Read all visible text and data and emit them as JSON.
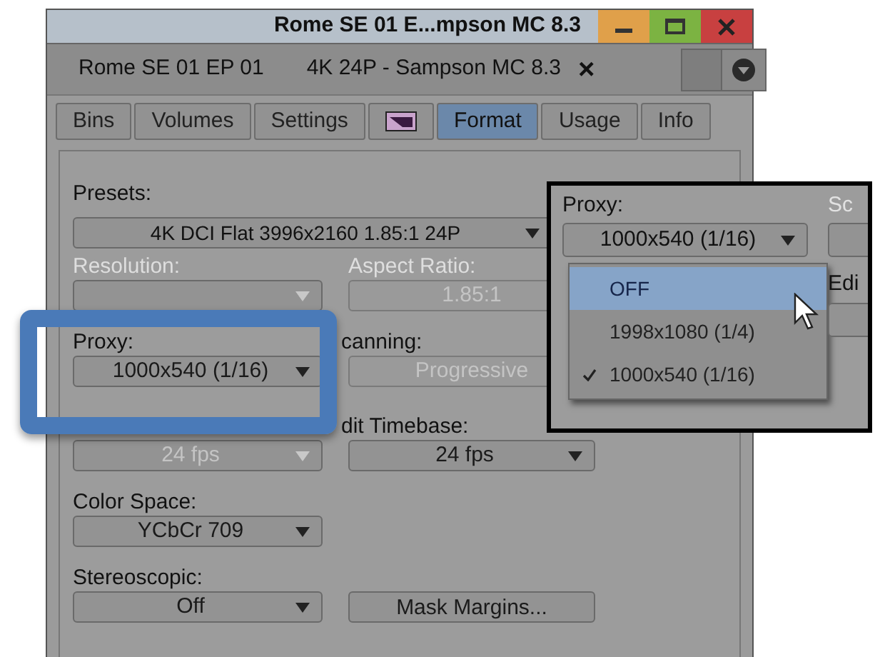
{
  "window": {
    "title": "Rome SE 01 E...mpson MC 8.3"
  },
  "document_tabs": [
    {
      "label": "Rome SE 01 EP 01"
    },
    {
      "label": "4K 24P - Sampson MC 8.3",
      "close": "×"
    }
  ],
  "tabs": [
    {
      "kind": "text",
      "label": "Bins",
      "selected": false
    },
    {
      "kind": "text",
      "label": "Volumes",
      "selected": false
    },
    {
      "kind": "text",
      "label": "Settings",
      "selected": false
    },
    {
      "kind": "icon",
      "selected": false
    },
    {
      "kind": "text",
      "label": "Format",
      "selected": true
    },
    {
      "kind": "text",
      "label": "Usage",
      "selected": false
    },
    {
      "kind": "text",
      "label": "Info",
      "selected": false
    }
  ],
  "presets": {
    "label": "Presets:",
    "value": "4K DCI Flat 3996x2160 1.85:1 24P"
  },
  "rows": [
    [
      {
        "kind": "dropdown",
        "label": "Resolution:",
        "disabled": true
      },
      {
        "kind": "field",
        "label": "Aspect Ratio:",
        "value": "1.85:1",
        "disabled": true
      }
    ],
    [
      {
        "kind": "dropdown",
        "label": "Proxy:",
        "value": "1000x540  (1/16)",
        "disabled": false
      },
      {
        "kind": "field",
        "label": "canning:",
        "value": "Progressive",
        "disabled": true
      }
    ],
    [
      {
        "kind": "dropdown",
        "value": "24 fps",
        "disabled": true
      },
      {
        "kind": "dropdown",
        "label": "dit Timebase:",
        "value": "24 fps",
        "disabled": false
      }
    ],
    [
      {
        "kind": "dropdown",
        "label": "Color Space:",
        "value": "YCbCr 709",
        "disabled": false
      }
    ],
    [
      {
        "kind": "dropdown",
        "label": "Stereoscopic:",
        "value": "Off",
        "disabled": false
      },
      {
        "kind": "button",
        "value": "Mask Margins...",
        "disabled": false
      }
    ]
  ],
  "inset": {
    "label": "Proxy:",
    "value": "1000x540  (1/16)",
    "side_labels": [
      "Sc",
      "Edi"
    ],
    "menu": [
      {
        "label": "OFF",
        "highlighted": true,
        "selected": false
      },
      {
        "label": "1998x1080  (1/4)",
        "highlighted": false,
        "selected": false
      },
      {
        "label": "1000x540  (1/16)",
        "highlighted": false,
        "selected": true
      }
    ]
  }
}
